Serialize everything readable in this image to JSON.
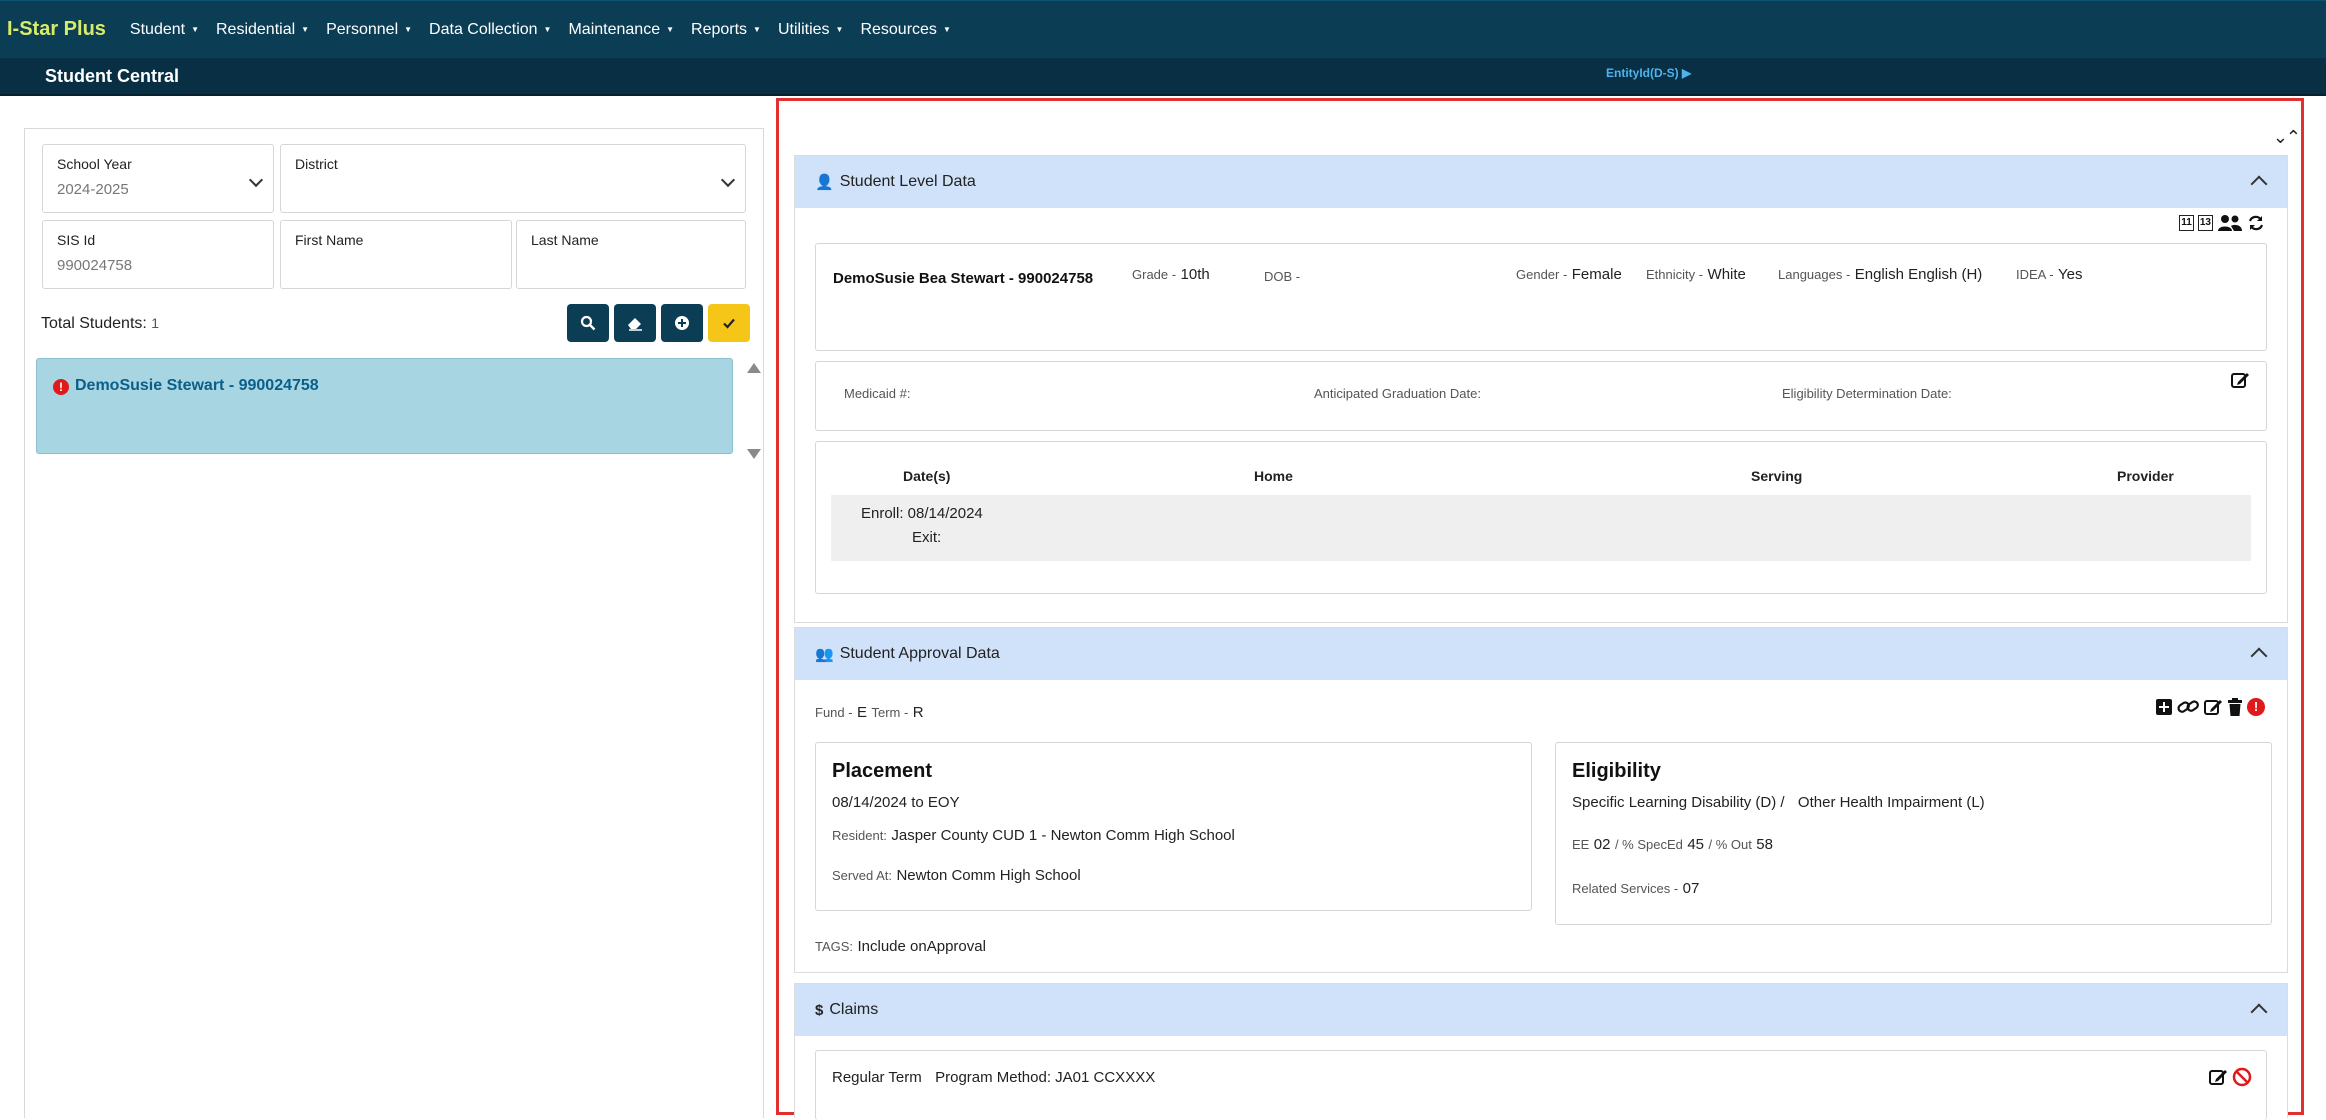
{
  "nav": {
    "brand": "I-Star Plus",
    "menu": [
      {
        "label": "Student"
      },
      {
        "label": "Residential"
      },
      {
        "label": "Personnel"
      },
      {
        "label": "Data Collection"
      },
      {
        "label": "Maintenance"
      },
      {
        "label": "Reports"
      },
      {
        "label": "Utilities"
      },
      {
        "label": "Resources"
      }
    ]
  },
  "subbar": {
    "title": "Student Central",
    "entity_link": "EntityId(D-S) ▶"
  },
  "search": {
    "school_year": {
      "label": "School Year",
      "value": "2024-2025"
    },
    "district": {
      "label": "District",
      "value": ""
    },
    "sis_id": {
      "label": "SIS Id",
      "value": "990024758"
    },
    "first_name": {
      "label": "First Name",
      "value": ""
    },
    "last_name": {
      "label": "Last Name",
      "value": ""
    },
    "total_label": "Total Students:",
    "total_count": "1",
    "result_name": "DemoSusie Stewart - 990024758"
  },
  "student_level": {
    "header": "Student Level Data",
    "name": "DemoSusie Bea Stewart - 990024758",
    "grade_label": "Grade -",
    "grade": "10th",
    "dob_label": "DOB -",
    "dob": "",
    "gender_label": "Gender -",
    "gender": "Female",
    "ethnicity_label": "Ethnicity -",
    "ethnicity": "White",
    "languages_label": "Languages -",
    "languages": "English English (H)",
    "idea_label": "IDEA -",
    "idea": "Yes",
    "icon_badge_1": "11",
    "icon_badge_2": "13",
    "medicaid_label": "Medicaid #:",
    "grad_label": "Anticipated Graduation Date:",
    "elig_date_label": "Eligibility Determination Date:",
    "table": {
      "headers": [
        "Date(s)",
        "Home",
        "Serving",
        "Provider"
      ],
      "enroll": "Enroll: 08/14/2024",
      "exit": "Exit:"
    }
  },
  "approval": {
    "header": "Student Approval Data",
    "fund_label": "Fund -",
    "fund": "E",
    "term_label": "Term -",
    "term": "R",
    "placement": {
      "title": "Placement",
      "dates": "08/14/2024 to EOY",
      "resident_label": "Resident:",
      "resident": "Jasper County CUD 1 - Newton Comm High School",
      "served_label": "Served At:",
      "served": "Newton Comm High School"
    },
    "eligibility": {
      "title": "Eligibility",
      "primary": "Specific Learning Disability (D) /",
      "secondary": "Other Health Impairment (L)",
      "ee_label": "EE",
      "ee": "02",
      "specd_label": "/ % SpecEd",
      "specd": "45",
      "out_label": "/ % Out",
      "out": "58",
      "related_label": "Related Services -",
      "related": "07"
    },
    "tags_label": "TAGS:",
    "tags": "Include onApproval"
  },
  "claims": {
    "header": "Claims",
    "term_label": "Regular Term",
    "program_method": "Program Method: JA01 CCXXXX"
  },
  "colors": {
    "nav_bg": "#0b3d55",
    "brand": "#d8ec6a",
    "section_header": "#cfe2fa",
    "highlight": "#e0302f",
    "selected_row": "#a8d5e2",
    "accent_yellow": "#f5c518"
  }
}
